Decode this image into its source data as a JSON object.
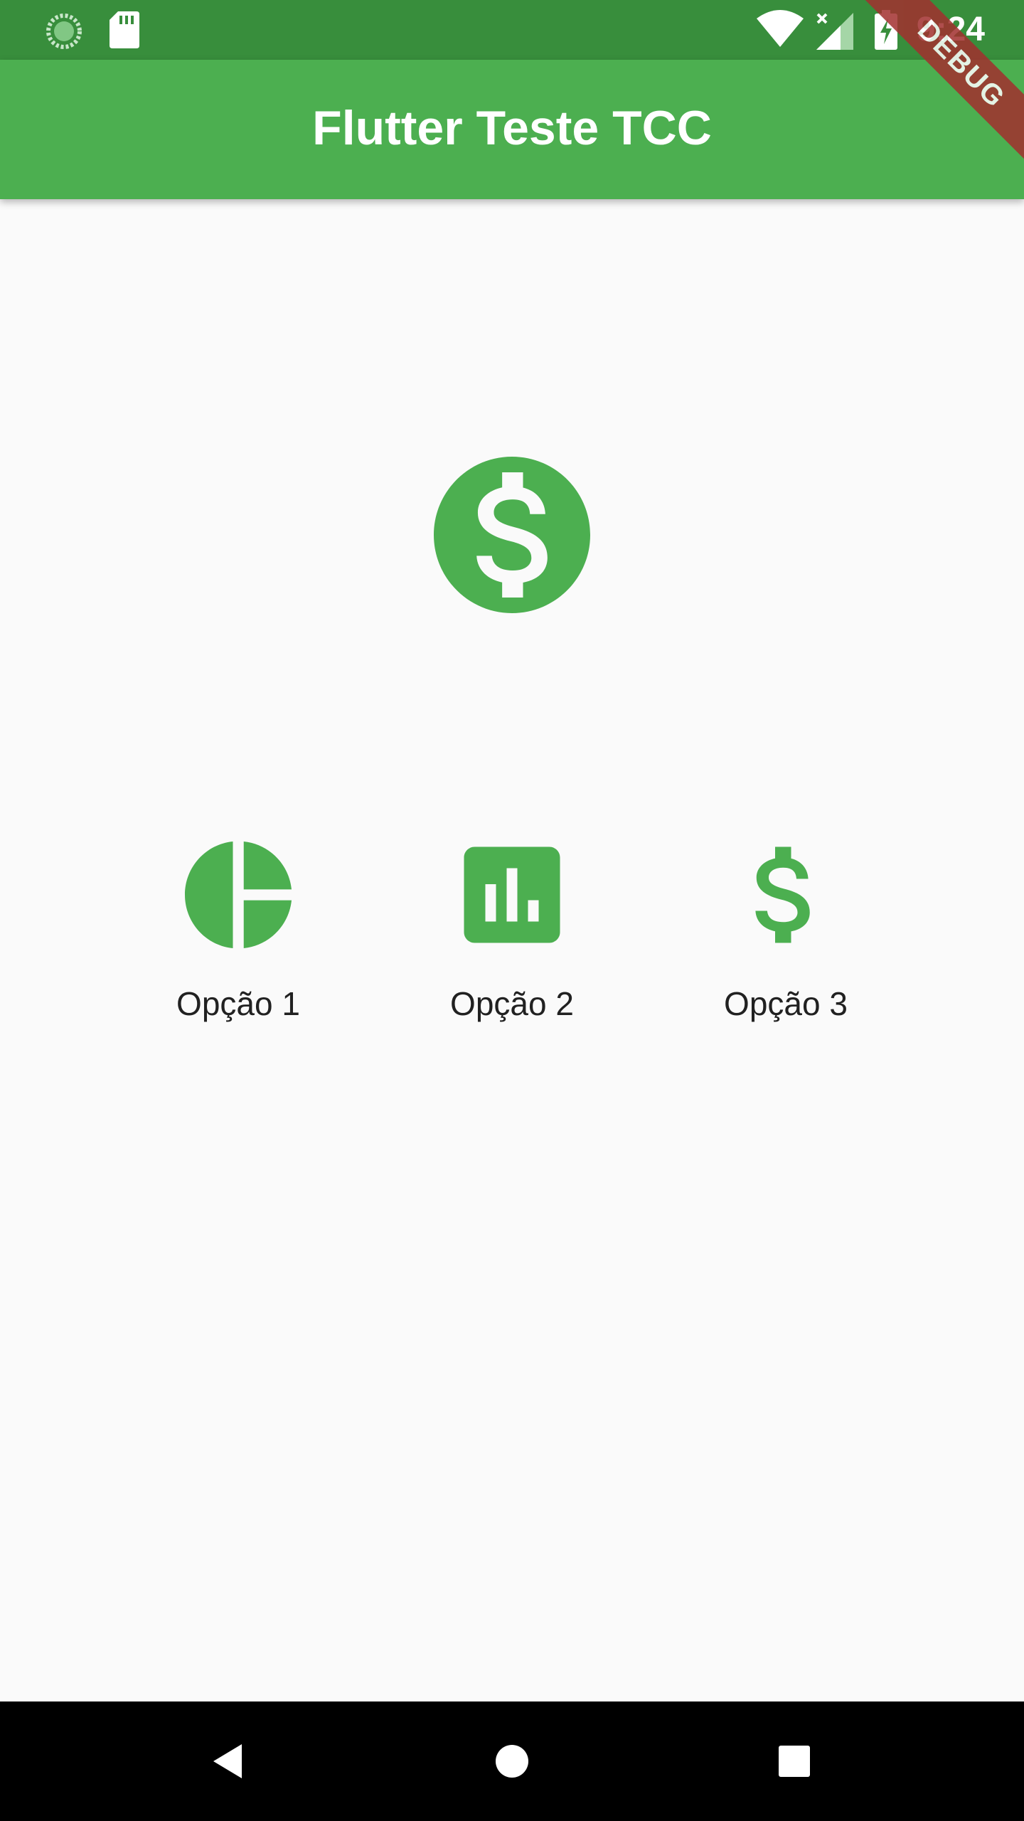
{
  "status_bar": {
    "time": "9:24",
    "left_icons": [
      "loading-icon",
      "sd-card-icon"
    ],
    "right_icons": [
      "wifi-icon",
      "signal-no-data-icon",
      "battery-charging-icon"
    ]
  },
  "app_bar": {
    "title": "Flutter Teste TCC"
  },
  "debug_banner": {
    "label": "DEBUG"
  },
  "hero": {
    "icon": "monetization-on-icon"
  },
  "options": [
    {
      "label": "Opção 1",
      "icon": "pie-chart-icon"
    },
    {
      "label": "Opção 2",
      "icon": "bar-chart-icon"
    },
    {
      "label": "Opção 3",
      "icon": "attach-money-icon"
    }
  ],
  "nav_bar": {
    "buttons": [
      "back-icon",
      "home-icon",
      "recents-icon"
    ]
  },
  "colors": {
    "primary": "#4caf50",
    "status_bar": "#388e3c",
    "background": "#fafafa",
    "debug": "#a2302f"
  }
}
